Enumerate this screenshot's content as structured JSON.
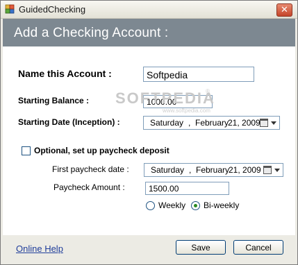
{
  "window": {
    "title": "GuidedChecking",
    "close_glyph": "✕"
  },
  "header": {
    "title": "Add a Checking Account :"
  },
  "form": {
    "name_label": "Name this Account :",
    "name_value": "Softpedia",
    "balance_label": "Starting Balance :",
    "balance_value": "1000.00",
    "start_date_label": "Starting Date (Inception) :",
    "start_date": {
      "day": "Saturday",
      "sep": ",",
      "month": "February",
      "date": "21, 2009"
    },
    "paycheck_checkbox_label": "Optional, set up paycheck deposit",
    "first_paycheck_label": "First paycheck date :",
    "first_paycheck_date": {
      "day": "Saturday",
      "sep": ",",
      "month": "February",
      "date": "21, 2009"
    },
    "paycheck_amount_label": "Paycheck Amount :",
    "paycheck_amount_value": "1500.00",
    "weekly_label": "Weekly",
    "biweekly_label": "Bi-weekly",
    "selected_frequency": "Bi-weekly"
  },
  "watermark": {
    "text": "SOFTPEDIA",
    "sub": "www.softpedia.com",
    "mark": "®"
  },
  "footer": {
    "help_link": "Online Help",
    "save_label": "Save",
    "cancel_label": "Cancel"
  },
  "colors": {
    "header_band": "#7d8891",
    "link": "#1f3d9a",
    "button_border": "#003c74"
  }
}
